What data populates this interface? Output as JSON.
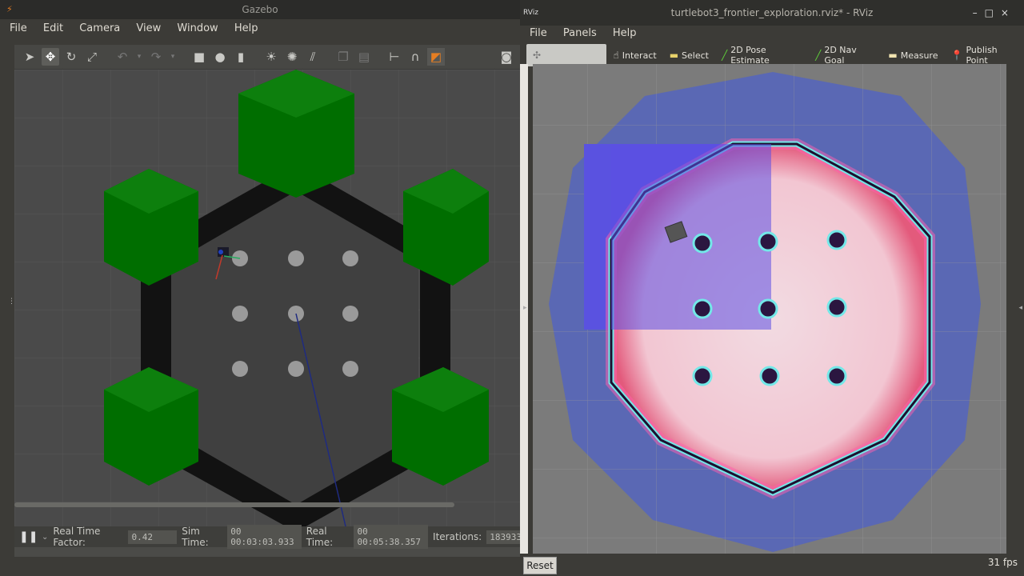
{
  "gazebo": {
    "title": "Gazebo",
    "menu": [
      "File",
      "Edit",
      "Camera",
      "View",
      "Window",
      "Help"
    ],
    "toolbar_icons": [
      "select-arrow-icon",
      "translate-icon",
      "rotate-icon",
      "scale-icon",
      "undo-icon",
      "redo-icon",
      "box-shape-icon",
      "sphere-shape-icon",
      "cylinder-shape-icon",
      "point-light-icon",
      "spot-light-icon",
      "directional-light-icon",
      "copy-icon",
      "paste-icon",
      "align-icon",
      "snap-icon",
      "view-angle-icon",
      "screenshot-icon"
    ],
    "status": {
      "real_time_factor_label": "Real Time Factor:",
      "real_time_factor": "0.42",
      "sim_time_label": "Sim Time:",
      "sim_time": "00 00:03:03.933",
      "real_time_label": "Real Time:",
      "real_time": "00 00:05:38.357",
      "iterations_label": "Iterations:",
      "iterations": "183933"
    }
  },
  "rviz": {
    "title": "turtlebot3_frontier_exploration.rviz* - RViz",
    "menu": [
      "File",
      "Panels",
      "Help"
    ],
    "tools": [
      {
        "label": "Interact",
        "icon": "interact-icon"
      },
      {
        "label": "Select",
        "icon": "select-icon"
      },
      {
        "label": "2D Pose Estimate",
        "icon": "pose-estimate-icon"
      },
      {
        "label": "2D Nav Goal",
        "icon": "nav-goal-icon"
      },
      {
        "label": "Measure",
        "icon": "measure-icon"
      },
      {
        "label": "Publish Point",
        "icon": "publish-point-icon"
      }
    ],
    "reset_label": "Reset",
    "fps": "31 fps"
  }
}
